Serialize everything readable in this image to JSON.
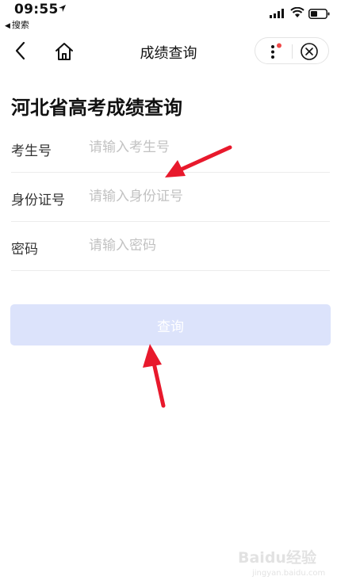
{
  "status_bar": {
    "time": "09:55",
    "back_app": "搜索"
  },
  "navbar": {
    "title": "成绩查询"
  },
  "page": {
    "heading": "河北省高考成绩查询"
  },
  "form": {
    "fields": [
      {
        "label": "考生号",
        "placeholder": "请输入考生号"
      },
      {
        "label": "身份证号",
        "placeholder": "请输入身份证号"
      },
      {
        "label": "密码",
        "placeholder": "请输入密码"
      }
    ],
    "submit_label": "查询"
  },
  "watermark": {
    "brand_text": "Baidu经验",
    "url_text": "jingyan.baidu.com"
  },
  "colors": {
    "accent_button": "#dce3fb",
    "arrow": "#e8192c",
    "badge": "#f04a4a"
  }
}
